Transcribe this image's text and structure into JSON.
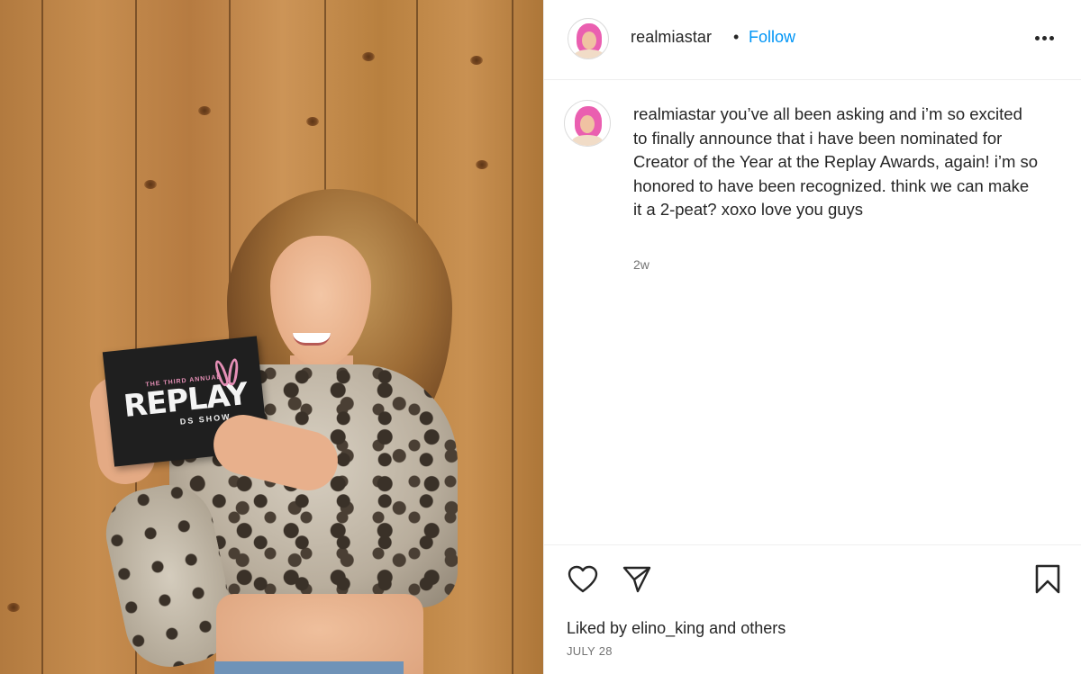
{
  "post": {
    "image": {
      "card_subtitle": "THE THIRD ANNUAL",
      "card_title": "REPLAY",
      "card_footer": "DS SHOW"
    },
    "header": {
      "username": "realmiastar",
      "separator": "•",
      "follow_label": "Follow",
      "more_icon": "more-horizontal-icon"
    },
    "caption": {
      "username": "realmiastar",
      "text": "you’ve all been asking and i’m so excited to finally announce that i have been nominated for Creator of the Year at the Replay Awards, again! i’m so honored to have been recognized. think we can make it a 2-peat? xoxo love you guys",
      "time_ago": "2w"
    },
    "actions": {
      "like_icon": "heart-icon",
      "share_icon": "paper-plane-icon",
      "save_icon": "bookmark-icon"
    },
    "likes": {
      "prefix": "Liked by",
      "user": "elino_king",
      "conjunction": "and",
      "others": "others"
    },
    "date": "JULY 28"
  },
  "colors": {
    "link_blue": "#0095f6",
    "text": "#262626",
    "secondary": "#737373",
    "border": "#efefef",
    "avatar_wig": "#ea5fb0"
  }
}
